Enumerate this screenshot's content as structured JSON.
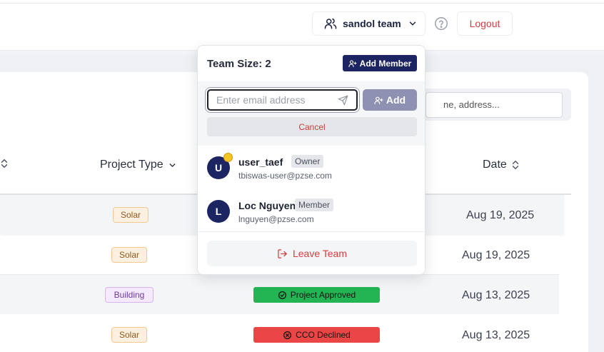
{
  "header": {
    "team_label": "sandol team",
    "logout_label": "Logout"
  },
  "search": {
    "placeholder_visible": "ne, address..."
  },
  "table": {
    "headers": {
      "project_type": "Project Type",
      "date": "Date"
    },
    "rows": [
      {
        "project_type": "Solar",
        "date": "Aug 19, 2025"
      },
      {
        "project_type": "Solar",
        "date": "Aug 19, 2025"
      },
      {
        "project_type": "Building",
        "status": "Project Approved",
        "date": "Aug 13, 2025"
      },
      {
        "project_type": "Solar",
        "status": "CCO Declined",
        "date": "Aug 13, 2025"
      }
    ]
  },
  "team_popover": {
    "title": "Team Size: 2",
    "add_member_label": "Add Member",
    "email_placeholder": "Enter email address",
    "add_label": "Add",
    "cancel_label": "Cancel",
    "members": [
      {
        "initial": "U",
        "name": "user_taef",
        "role": "Owner",
        "email": "tbiswas-user@pzse.com"
      },
      {
        "initial": "L",
        "name": "Loc Nguyen",
        "role": "Member",
        "email": "lnguyen@pzse.com"
      }
    ],
    "leave_label": "Leave Team"
  },
  "colors": {
    "brand_navy": "#1c2461",
    "danger": "#d43d3d",
    "approved": "#23b553",
    "declined": "#ea4646"
  },
  "icons": {
    "team": "users-icon",
    "chevron": "chevron-down-icon",
    "help": "help-circle-icon",
    "send": "send-icon",
    "add_user": "user-plus-icon",
    "leave": "log-out-icon",
    "owner": "crown-icon",
    "approved": "check-circle-icon",
    "declined": "x-circle-icon",
    "sort": "sort-icon"
  }
}
